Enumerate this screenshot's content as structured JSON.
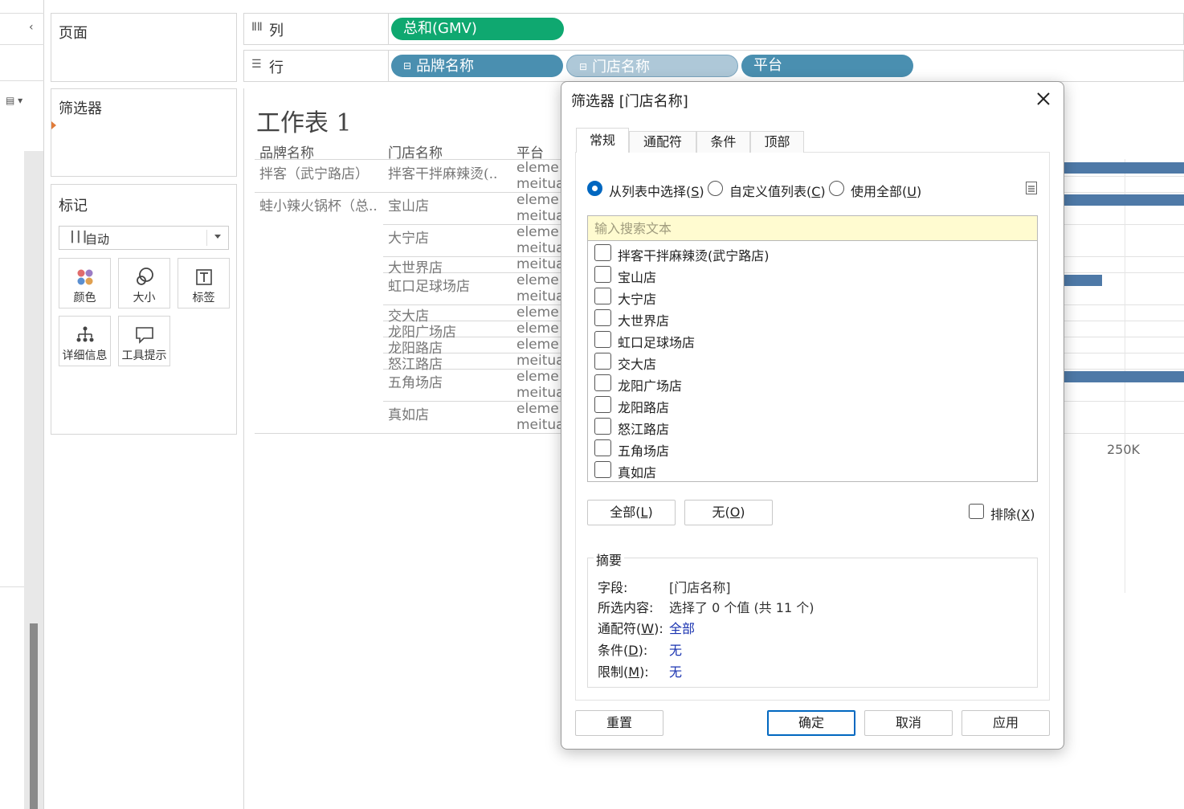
{
  "shelves": {
    "pages_title": "页面",
    "filters_title": "筛选器",
    "marks_title": "标记",
    "marks_type": "自动",
    "mark_buttons": [
      "颜色",
      "大小",
      "标签",
      "详细信息",
      "工具提示"
    ],
    "columns_label": "列",
    "rows_label": "行",
    "columns_pills": [
      "总和(GMV)"
    ],
    "rows_pills": [
      "品牌名称",
      "门店名称",
      "平台"
    ]
  },
  "worksheet": {
    "title": "工作表 1",
    "headers": [
      "品牌名称",
      "门店名称",
      "平台"
    ],
    "brands": [
      "拌客（武宁路店）",
      "蛙小辣火锅杯（总.."
    ],
    "stores": [
      "拌客干拌麻辣烫(..",
      "宝山店",
      "大宁店",
      "大世界店",
      "虹口足球场店",
      "交大店",
      "龙阳广场店",
      "龙阳路店",
      "怒江路店",
      "五角场店",
      "真如店"
    ],
    "platforms": [
      "eleme",
      "meitua",
      "eleme",
      "meitua",
      "eleme",
      "meitua",
      "meitua",
      "eleme",
      "meitua",
      "eleme",
      "eleme",
      "eleme",
      "meitua",
      "eleme",
      "meitua",
      "eleme",
      "meitua"
    ],
    "axis_tick": "250K"
  },
  "dialog": {
    "title": "筛选器 [门店名称]",
    "tabs": [
      "常规",
      "通配符",
      "条件",
      "顶部"
    ],
    "radio_from_list": "从列表中选择(",
    "radio_from_list_key": "S",
    "radio_custom": "自定义值列表(",
    "radio_custom_key": "C",
    "radio_all": "使用全部(",
    "radio_all_key": "U",
    "close_paren": ")",
    "search_placeholder": "输入搜索文本",
    "items": [
      "拌客干拌麻辣烫(武宁路店)",
      "宝山店",
      "大宁店",
      "大世界店",
      "虹口足球场店",
      "交大店",
      "龙阳广场店",
      "龙阳路店",
      "怒江路店",
      "五角场店",
      "真如店"
    ],
    "btn_all": "全部(",
    "btn_all_key": "L",
    "btn_none": "无(",
    "btn_none_key": "O",
    "exclude": "排除(",
    "exclude_key": "X",
    "summary_title": "摘要",
    "summary": {
      "field_label": "字段:",
      "field_value": "[门店名称]",
      "selected_label": "所选内容:",
      "selected_value": "选择了 0 个值 (共 11 个)",
      "wildcard_label_a": "通配符(",
      "wildcard_key": "W",
      "wildcard_label_b": "):",
      "wildcard_value": "全部",
      "condition_label_a": "条件(",
      "condition_key": "D",
      "condition_label_b": "):",
      "condition_value": "无",
      "limit_label_a": "限制(",
      "limit_key": "M",
      "limit_label_b": "):",
      "limit_value": "无"
    },
    "btn_reset": "重置",
    "btn_ok": "确定",
    "btn_cancel": "取消",
    "btn_apply": "应用"
  },
  "colors": {
    "measure_pill": "#0fa870",
    "dimension_pill": "#4a8fb0",
    "bar": "#4e79a7",
    "link": "#1a33b0",
    "radio_selected": "#0067c0"
  }
}
